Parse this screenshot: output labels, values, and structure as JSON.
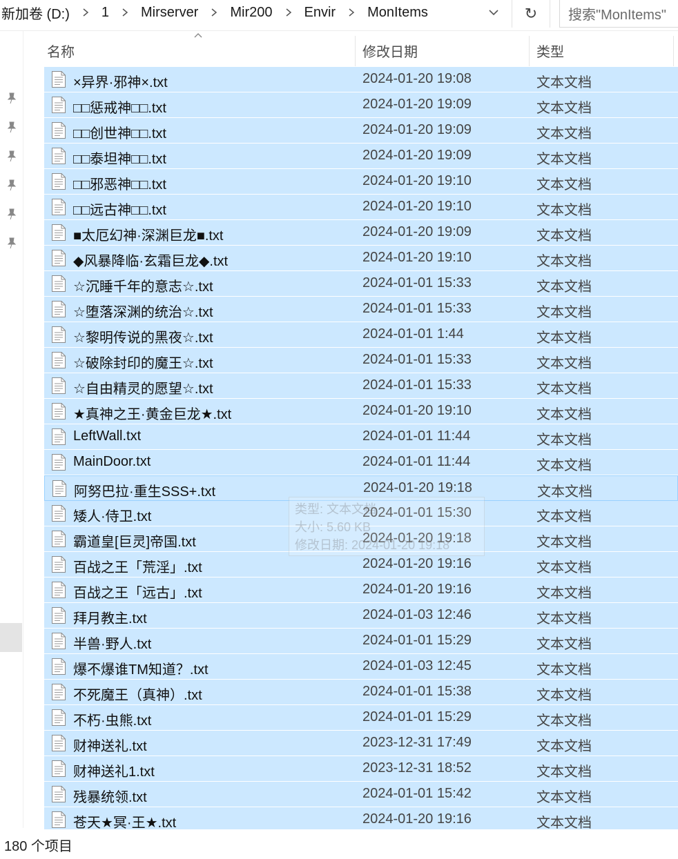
{
  "breadcrumb": [
    "新加卷 (D:)",
    "1",
    "Mirserver",
    "Mir200",
    "Envir",
    "MonItems"
  ],
  "search": {
    "placeholder": "搜索\"MonItems\""
  },
  "columns": {
    "name": "名称",
    "date": "修改日期",
    "type": "类型"
  },
  "files": [
    {
      "name": "×异界·邪神×.txt",
      "date": "2024-01-20 19:08",
      "type": "文本文档"
    },
    {
      "name": "□□惩戒神□□.txt",
      "date": "2024-01-20 19:09",
      "type": "文本文档"
    },
    {
      "name": "□□创世神□□.txt",
      "date": "2024-01-20 19:09",
      "type": "文本文档"
    },
    {
      "name": "□□泰坦神□□.txt",
      "date": "2024-01-20 19:09",
      "type": "文本文档"
    },
    {
      "name": "□□邪恶神□□.txt",
      "date": "2024-01-20 19:10",
      "type": "文本文档"
    },
    {
      "name": "□□远古神□□.txt",
      "date": "2024-01-20 19:10",
      "type": "文本文档"
    },
    {
      "name": "■太厄幻神·深渊巨龙■.txt",
      "date": "2024-01-20 19:09",
      "type": "文本文档"
    },
    {
      "name": "◆风暴降临·玄霜巨龙◆.txt",
      "date": "2024-01-20 19:10",
      "type": "文本文档"
    },
    {
      "name": "☆沉睡千年的意志☆.txt",
      "date": "2024-01-01 15:33",
      "type": "文本文档"
    },
    {
      "name": "☆堕落深渊的统治☆.txt",
      "date": "2024-01-01 15:33",
      "type": "文本文档"
    },
    {
      "name": "☆黎明传说的黑夜☆.txt",
      "date": "2024-01-01 1:44",
      "type": "文本文档"
    },
    {
      "name": "☆破除封印的魔王☆.txt",
      "date": "2024-01-01 15:33",
      "type": "文本文档"
    },
    {
      "name": "☆自由精灵的愿望☆.txt",
      "date": "2024-01-01 15:33",
      "type": "文本文档"
    },
    {
      "name": "★真神之王·黄金巨龙★.txt",
      "date": "2024-01-20 19:10",
      "type": "文本文档"
    },
    {
      "name": "LeftWall.txt",
      "date": "2024-01-01 11:44",
      "type": "文本文档"
    },
    {
      "name": "MainDoor.txt",
      "date": "2024-01-01 11:44",
      "type": "文本文档"
    },
    {
      "name": "阿努巴拉·重生SSS+.txt",
      "date": "2024-01-20 19:18",
      "type": "文本文档"
    },
    {
      "name": "矮人·侍卫.txt",
      "date": "2024-01-01 15:30",
      "type": "文本文档"
    },
    {
      "name": "霸道皇[巨灵]帝国.txt",
      "date": "2024-01-20 19:18",
      "type": "文本文档"
    },
    {
      "name": "百战之王「荒淫」.txt",
      "date": "2024-01-20 19:16",
      "type": "文本文档"
    },
    {
      "name": "百战之王「远古」.txt",
      "date": "2024-01-20 19:16",
      "type": "文本文档"
    },
    {
      "name": "拜月教主.txt",
      "date": "2024-01-03 12:46",
      "type": "文本文档"
    },
    {
      "name": "半兽·野人.txt",
      "date": "2024-01-01 15:29",
      "type": "文本文档"
    },
    {
      "name": "爆不爆谁TM知道？.txt",
      "date": "2024-01-03 12:45",
      "type": "文本文档"
    },
    {
      "name": "不死魔王（真神）.txt",
      "date": "2024-01-01 15:38",
      "type": "文本文档"
    },
    {
      "name": "不朽·虫熊.txt",
      "date": "2024-01-01 15:29",
      "type": "文本文档"
    },
    {
      "name": "财神送礼.txt",
      "date": "2023-12-31 17:49",
      "type": "文本文档"
    },
    {
      "name": "财神送礼1.txt",
      "date": "2023-12-31 18:52",
      "type": "文本文档"
    },
    {
      "name": "残暴统领.txt",
      "date": "2024-01-01 15:42",
      "type": "文本文档"
    },
    {
      "name": "苍天★冥·王★.txt",
      "date": "2024-01-20 19:16",
      "type": "文本文档"
    }
  ],
  "tooltip": {
    "line1": "类型: 文本文档",
    "line2": "大小: 5.60 KB",
    "line3": "修改日期: 2024-01-20 19:18"
  },
  "status": {
    "count": "180 个项目"
  },
  "colors": {
    "selection": "#cce8ff",
    "focus_border": "#99d1ff",
    "nav_selected": "#e4e4e4"
  },
  "icons": {
    "file": "text-file-icon",
    "pin": "pin-icon",
    "chevron": "chevron-right-icon",
    "refresh": "refresh-icon"
  }
}
